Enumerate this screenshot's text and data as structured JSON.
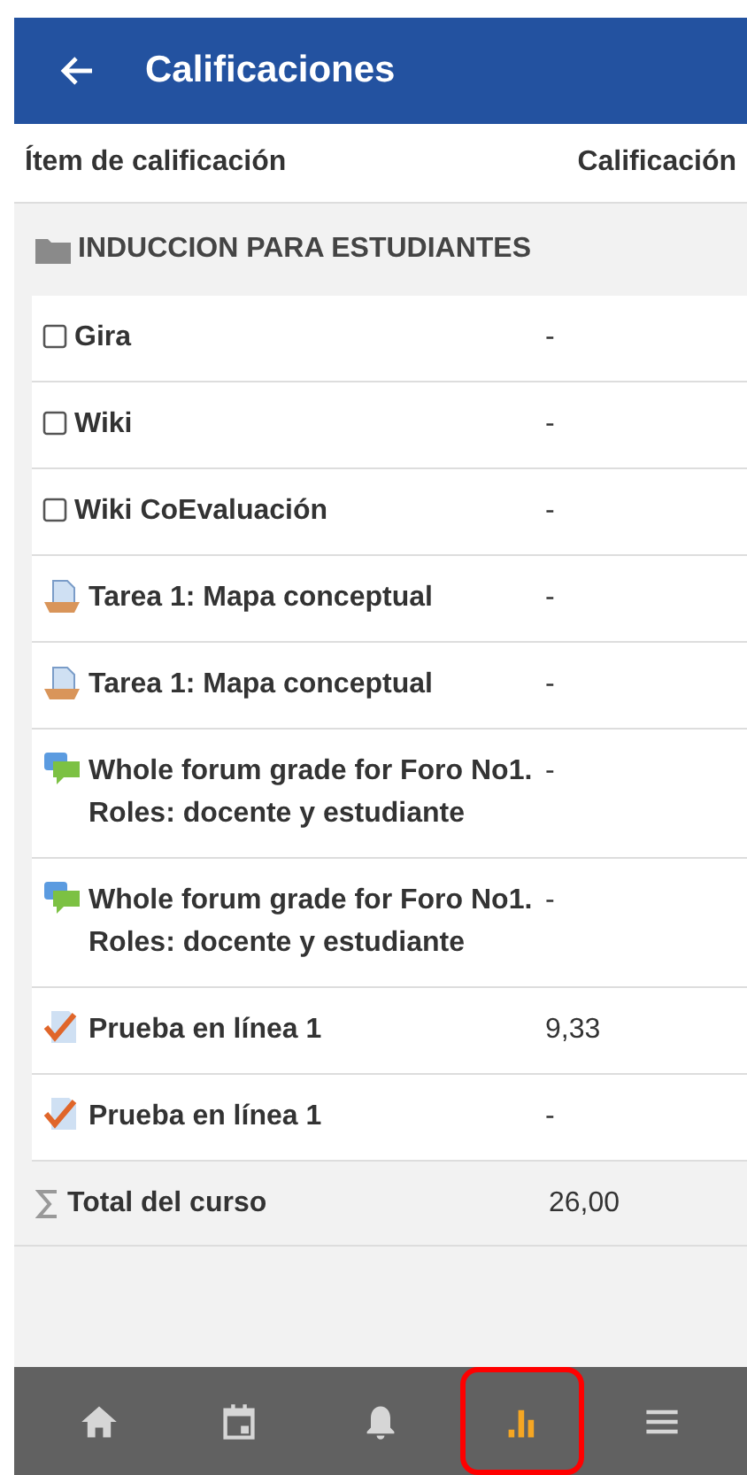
{
  "header": {
    "title": "Calificaciones"
  },
  "table": {
    "columns": [
      "Ítem de calificación",
      "Calificación"
    ],
    "category": "INDUCCION PARA ESTUDIANTES",
    "rows": [
      {
        "kind": "checkbox",
        "item": "Gira",
        "grade": "-"
      },
      {
        "kind": "checkbox",
        "item": "Wiki",
        "grade": "-"
      },
      {
        "kind": "checkbox",
        "item": "Wiki CoEvaluación",
        "grade": "-"
      },
      {
        "kind": "assignment",
        "item": "Tarea 1: Mapa conceptual",
        "grade": "-"
      },
      {
        "kind": "assignment",
        "item": "Tarea 1: Mapa conceptual",
        "grade": "-"
      },
      {
        "kind": "forum",
        "item": "Whole forum grade for Foro No1. Roles: docente y estudiante",
        "grade": "-"
      },
      {
        "kind": "forum",
        "item": "Whole forum grade for Foro No1. Roles: docente y estudiante",
        "grade": "-"
      },
      {
        "kind": "quiz",
        "item": "Prueba en línea 1",
        "grade": "9,33"
      },
      {
        "kind": "quiz",
        "item": "Prueba en línea 1",
        "grade": "-"
      }
    ],
    "total": {
      "item": "Total del curso",
      "grade": "26,00"
    }
  },
  "bottom_nav": [
    {
      "kind": "home",
      "selected": false
    },
    {
      "kind": "calendar",
      "selected": false
    },
    {
      "kind": "bell",
      "selected": false
    },
    {
      "kind": "grades",
      "selected": true
    },
    {
      "kind": "menu",
      "selected": false
    }
  ]
}
